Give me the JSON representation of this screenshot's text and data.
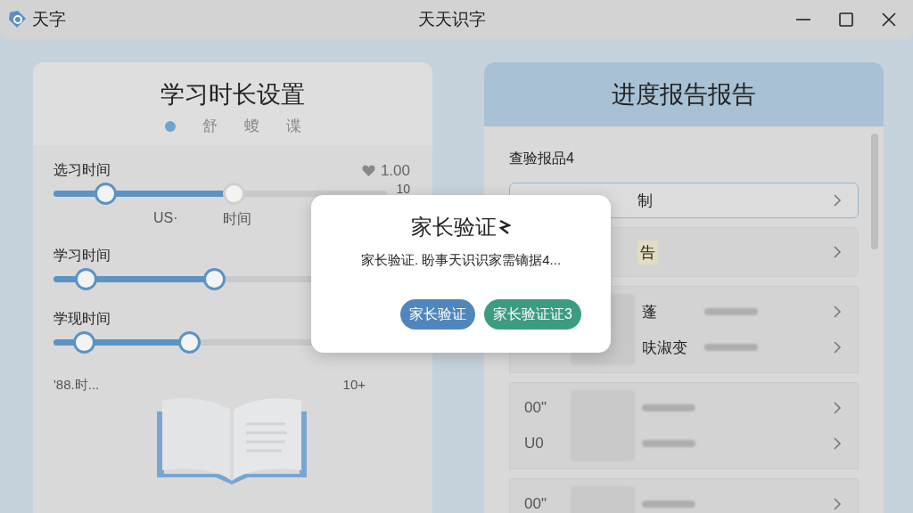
{
  "window": {
    "app_name": "天字",
    "title": "天天识字"
  },
  "settings_panel": {
    "title": "学习时长设置",
    "tabs": [
      {
        "kind": "dot",
        "selected": true
      },
      {
        "kind": "text",
        "label": "舒",
        "selected": false
      },
      {
        "kind": "text",
        "label": "蝬",
        "selected": false
      },
      {
        "kind": "text",
        "label": "谍",
        "selected": false
      }
    ],
    "sliders": [
      {
        "label": "选习时间",
        "value": "1.00",
        "max": "10",
        "thumbs": [
          {
            "level": 0.155
          },
          {
            "level": 0.54
          }
        ],
        "ticks": [
          "US·",
          "时间"
        ]
      },
      {
        "label": "学习时间",
        "thumbs": [
          {
            "level": 0.09
          },
          {
            "level": 0.45
          }
        ]
      },
      {
        "label": "学现时间",
        "thumbs": [
          {
            "level": 0.085
          },
          {
            "level": 0.38
          }
        ]
      }
    ],
    "footer_left": "'88.时...",
    "footer_right": "10+"
  },
  "report_panel": {
    "title": "进度报告报告",
    "subtitle": "查验报品4",
    "rows": [
      {
        "kind": "outlined",
        "label": "制"
      },
      {
        "kind": "tag",
        "label": "告"
      },
      {
        "kind": "group",
        "items": [
          {
            "title": "蓬"
          },
          {
            "title": "呋淑变"
          }
        ]
      },
      {
        "kind": "group",
        "items": [
          {
            "time": "00\""
          },
          {
            "time": "U0"
          }
        ]
      },
      {
        "kind": "group",
        "items": [
          {
            "time": "00\""
          }
        ]
      }
    ]
  },
  "dialog": {
    "title": "家长验证",
    "message": "家长验证. 盼事天识识家需镝据4...",
    "buttons": [
      {
        "label": "家长验证",
        "kind": "primary"
      },
      {
        "label": "家长验证证3",
        "kind": "success"
      }
    ]
  }
}
